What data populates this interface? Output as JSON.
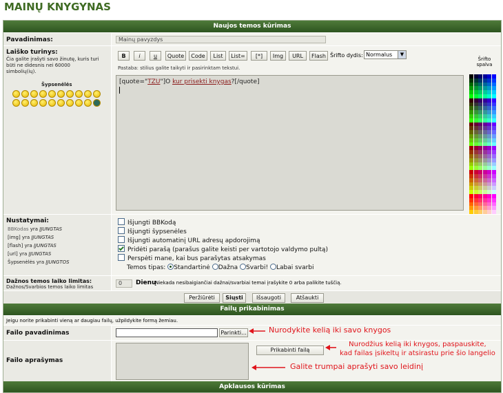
{
  "page_title": "MAINŲ KNYGYNAS",
  "header_bar": "Naujos temos kūrimas",
  "subject": {
    "label": "Pavadinimas:",
    "value": "Mainų pavyzdys"
  },
  "message": {
    "label": "Laiško turinys:",
    "hint_lines": [
      "Čia galite įrašyti savo žinutę, kuris turi",
      "būti ne didesnis nei 60000",
      "simbolių(ių)."
    ],
    "smileys_label": "Šypsenėlės",
    "content_part1": "[quote=\"",
    "content_link1": "TZU",
    "content_part2": "\"]O ",
    "content_link2": "kur prisekti knygas",
    "content_part3": "?[/quote]"
  },
  "toolbar": {
    "buttons": [
      "B",
      "i",
      "u",
      "Quote",
      "Code",
      "List",
      "List=",
      "[*]",
      "Img",
      "URL",
      "Flash"
    ],
    "font_size_label": "Šrifto dydis:",
    "font_size_value": "Normalus",
    "tip": "Pastaba: stilius galite taikyti ir pasirinktam tekstui."
  },
  "font_color_label_1": "Šrifto",
  "font_color_label_2": "spalva",
  "settings": {
    "label": "Nustatymai:",
    "bbcode_name": "BBKodas",
    "bbcode_mid": "yra",
    "bbcode_status": "ĮJUNGTAS",
    "img_name": "[img]",
    "img_mid": "yra",
    "img_status": "ĮJUNGTAS",
    "flash_name": "[flash]",
    "flash_mid": "yra",
    "flash_status": "ĮJUNGTAS",
    "url_name": "[url]",
    "url_mid": "yra",
    "url_status": "ĮJUNGTAS",
    "smileys_name": "Šypsenėlės",
    "smileys_mid": "yra",
    "smileys_status": "ĮJUNGTOS",
    "options": [
      {
        "label": "Išjungti BBKodą",
        "checked": false
      },
      {
        "label": "Išjungti šypsenėles",
        "checked": false
      },
      {
        "label": "Išjungti automatinį URL adresų apdorojimą",
        "checked": false
      },
      {
        "label": "Pridėti parašą (parašus galite keisti per vartotojo valdymo pultą)",
        "checked": true
      },
      {
        "label": "Perspėti mane, kai bus parašytas atsakymas",
        "checked": false
      }
    ],
    "topic_type_label": "Temos tipas:",
    "topic_types": [
      {
        "label": "Standartinė",
        "selected": true
      },
      {
        "label": "Dažna",
        "selected": false
      },
      {
        "label": "Svarbi!",
        "selected": false
      },
      {
        "label": "Labai svarbi",
        "selected": false
      }
    ]
  },
  "sticky": {
    "label": "Dažnos temos laiko limitas:",
    "sublabel": "Dažnos/Svarbios temos laiko limitas",
    "value": "0",
    "unit": "Dienų",
    "hint": "Niekada nesibaigiančiai dažnai/svarbiai temai įrašykite 0 arba palikite tuščią."
  },
  "actions": {
    "preview": "Peržiūrėti",
    "submit": "Siųsti",
    "save": "Išsaugoti",
    "cancel": "Atšaukti"
  },
  "attach": {
    "bar": "Failų prikabinimas",
    "intro": "Jeigu norite prikabinti vieną ar daugiau failų, užpildykite formą žemiau.",
    "filename_label": "Failo pavadinimas",
    "browse": "Parinkti...",
    "desc_label": "Failo aprašymas",
    "attach_button": "Prikabinti failą"
  },
  "poll_bar": "Apklausos kūrimas",
  "annotations": {
    "a1": "Nurodykite kelią iki savo knygos",
    "a2_line1": "Nurodžius kelią iki knygos, paspauskite,",
    "a2_line2": "kad failas įsikeltų ir atsirastu prie šio langelio",
    "a3": "Galite trumpai aprašyti savo leidinį"
  },
  "colors": {
    "brand": "#3f6b23",
    "bar": "#2e5520",
    "annotation": "#e0141b"
  }
}
